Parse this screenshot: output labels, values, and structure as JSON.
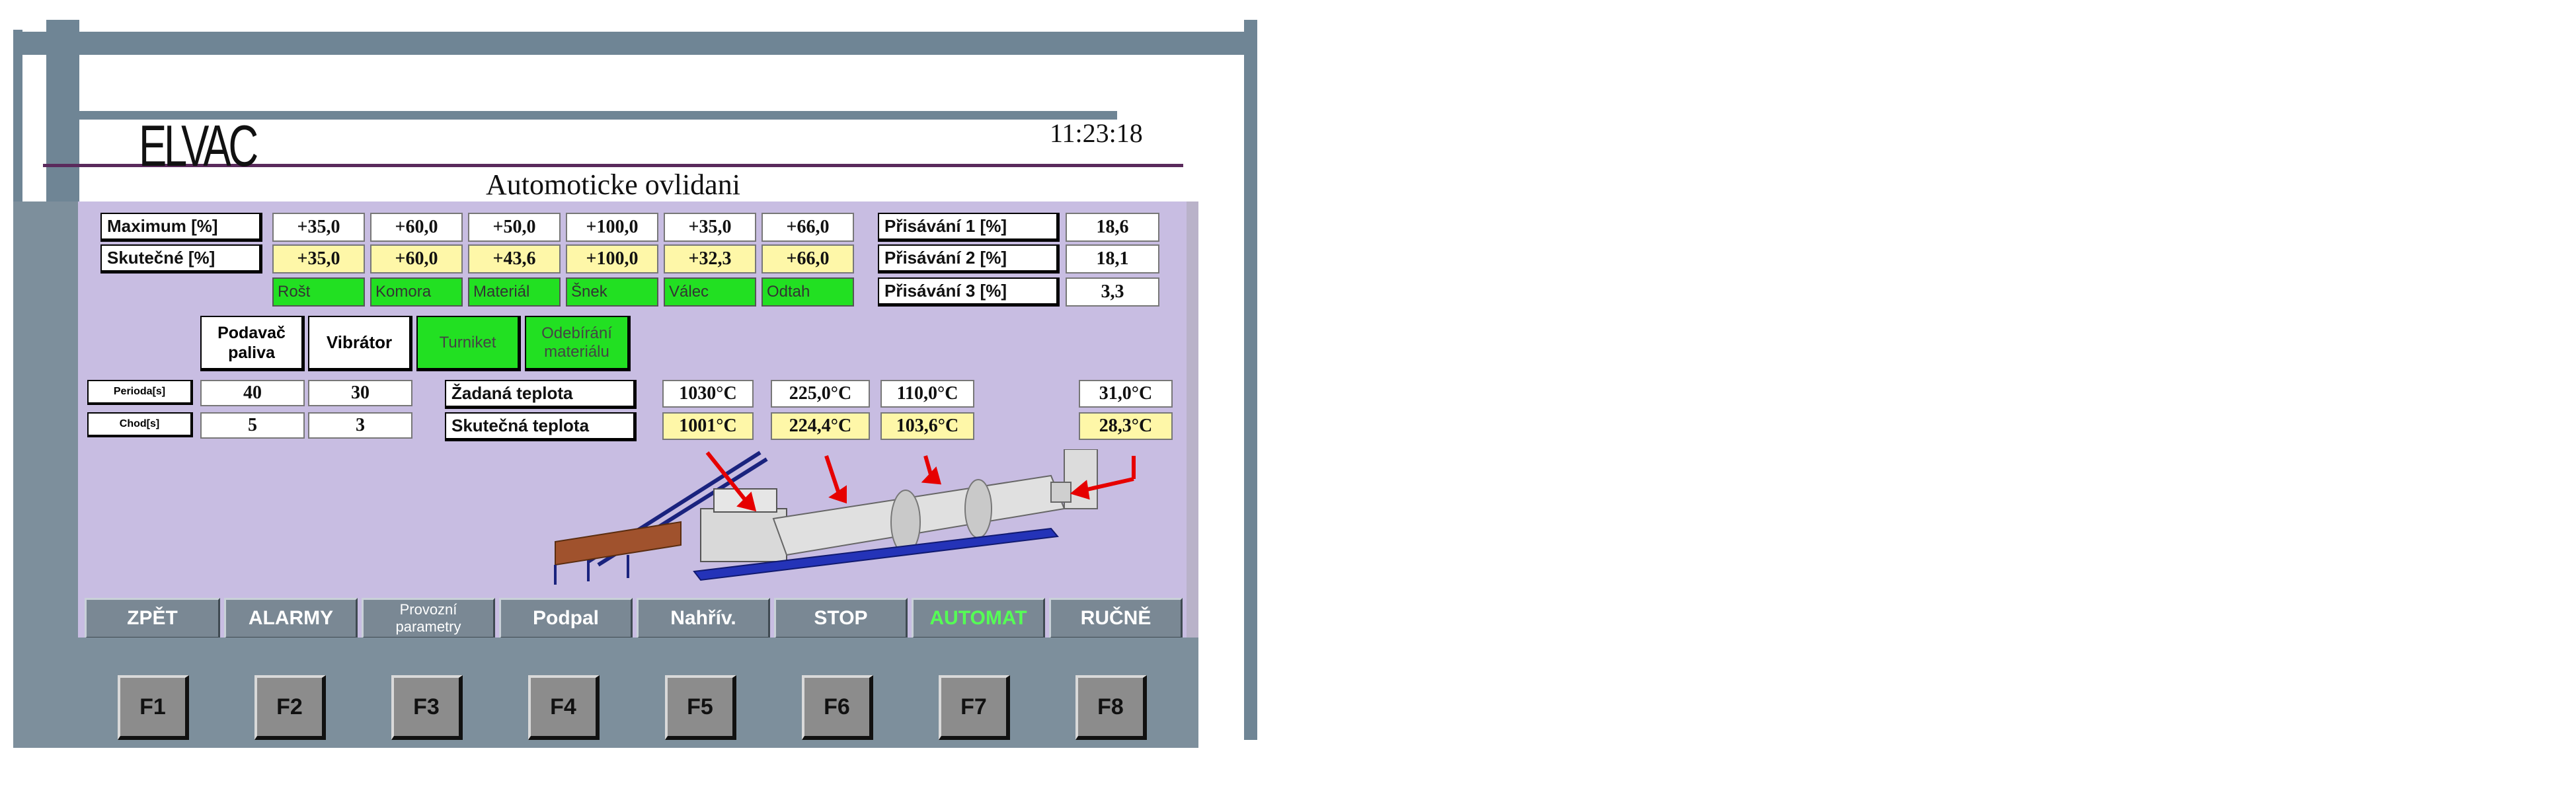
{
  "header": {
    "brand": "ELVAC",
    "time": "11:23:18",
    "title": "Automoticke ovlidani"
  },
  "rows": {
    "maximum": {
      "label": "Maximum [%]",
      "values": [
        "+35,0",
        "+60,0",
        "+50,0",
        "+100,0",
        "+35,0",
        "+66,0"
      ]
    },
    "actual": {
      "label": "Skutečné [%]",
      "values": [
        "+35,0",
        "+60,0",
        "+43,6",
        "+100,0",
        "+32,3",
        "+66,0"
      ]
    },
    "indicators": [
      "Rošt",
      "Komora",
      "Materiál",
      "Šnek",
      "Válec",
      "Odtah"
    ]
  },
  "suction": [
    {
      "label": "Přisávání 1 [%]",
      "value": "18,6"
    },
    {
      "label": "Přisávání 2 [%]",
      "value": "18,1"
    },
    {
      "label": "Přisávání 3 [%]",
      "value": "3,3"
    }
  ],
  "devices": {
    "podavac": "Podavač paliva",
    "vibrator": "Vibrátor",
    "turniket": "Turniket",
    "odebirani": "Odebírání materiálu"
  },
  "timing": {
    "perioda_label": "Perioda[s]",
    "chod_label": "Chod[s]",
    "perioda": [
      "40",
      "30"
    ],
    "chod": [
      "5",
      "3"
    ]
  },
  "temps": {
    "zadana_label": "Žadaná teplota",
    "skutecna_label": "Skutečná teplota",
    "zadana": [
      "1030°C",
      "225,0°C",
      "110,0°C",
      "31,0°C"
    ],
    "skutecna": [
      "1001°C",
      "224,4°C",
      "103,6°C",
      "28,3°C"
    ]
  },
  "menu": [
    "ZPĚT",
    "ALARMY",
    "Provozní parametry",
    "Podpal",
    "Nahřív.",
    "STOP",
    "AUTOMAT",
    "RUČNĚ"
  ],
  "fkeys": [
    "F1",
    "F2",
    "F3",
    "F4",
    "F5",
    "F6",
    "F7",
    "F8"
  ],
  "colors": {
    "hmi_bg": "#c8bde2",
    "indicator_green": "#22e022",
    "actual_yellow": "#fef7a8",
    "frame": "#6f8595",
    "automat_text": "#55ff55"
  }
}
